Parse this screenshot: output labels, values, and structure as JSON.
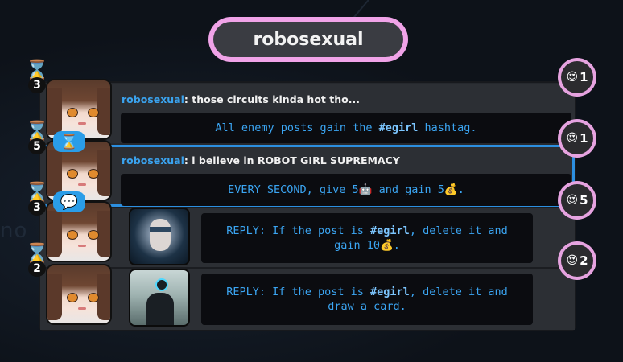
{
  "title": "robosexual",
  "background_text": "no",
  "posts": [
    {
      "author": "robosexual",
      "sep": ": ",
      "text": "those circuits kinda hot tho...",
      "effect_pre": "All enemy posts gain the ",
      "effect_tag": "#egirl",
      "effect_post": " hashtag.",
      "timer": "3",
      "likes": "1"
    },
    {
      "author": "robosexual",
      "sep": ": ",
      "text": "i believe in ROBOT GIRL SUPREMACY",
      "effect_pre": "EVERY SECOND, give 5",
      "effect_icon1": "🤖",
      "effect_mid": " and gain 5",
      "effect_icon2": "💰",
      "effect_post": ".",
      "timer": "5",
      "likes": "1"
    }
  ],
  "replies": [
    {
      "line1_pre": "REPLY: If the post is ",
      "tag": "#egirl",
      "line1_post": ", delete it and",
      "line2": "gain 10",
      "line2_icon": "💰",
      "line2_post": ".",
      "timer": "3",
      "likes": "5"
    },
    {
      "line1_pre": "REPLY: If the post is ",
      "tag": "#egirl",
      "line1_post": ", delete it and",
      "line2": "draw a card.",
      "line2_icon": "",
      "line2_post": "",
      "timer": "2",
      "likes": "2"
    }
  ],
  "icons": {
    "hourglass": "⌛",
    "chat": "💬",
    "heart_eyes": "😍"
  },
  "colors": {
    "accent_blue": "#2c8fe0",
    "pink": "#f0a3e8",
    "orange": "#f2a23b"
  }
}
